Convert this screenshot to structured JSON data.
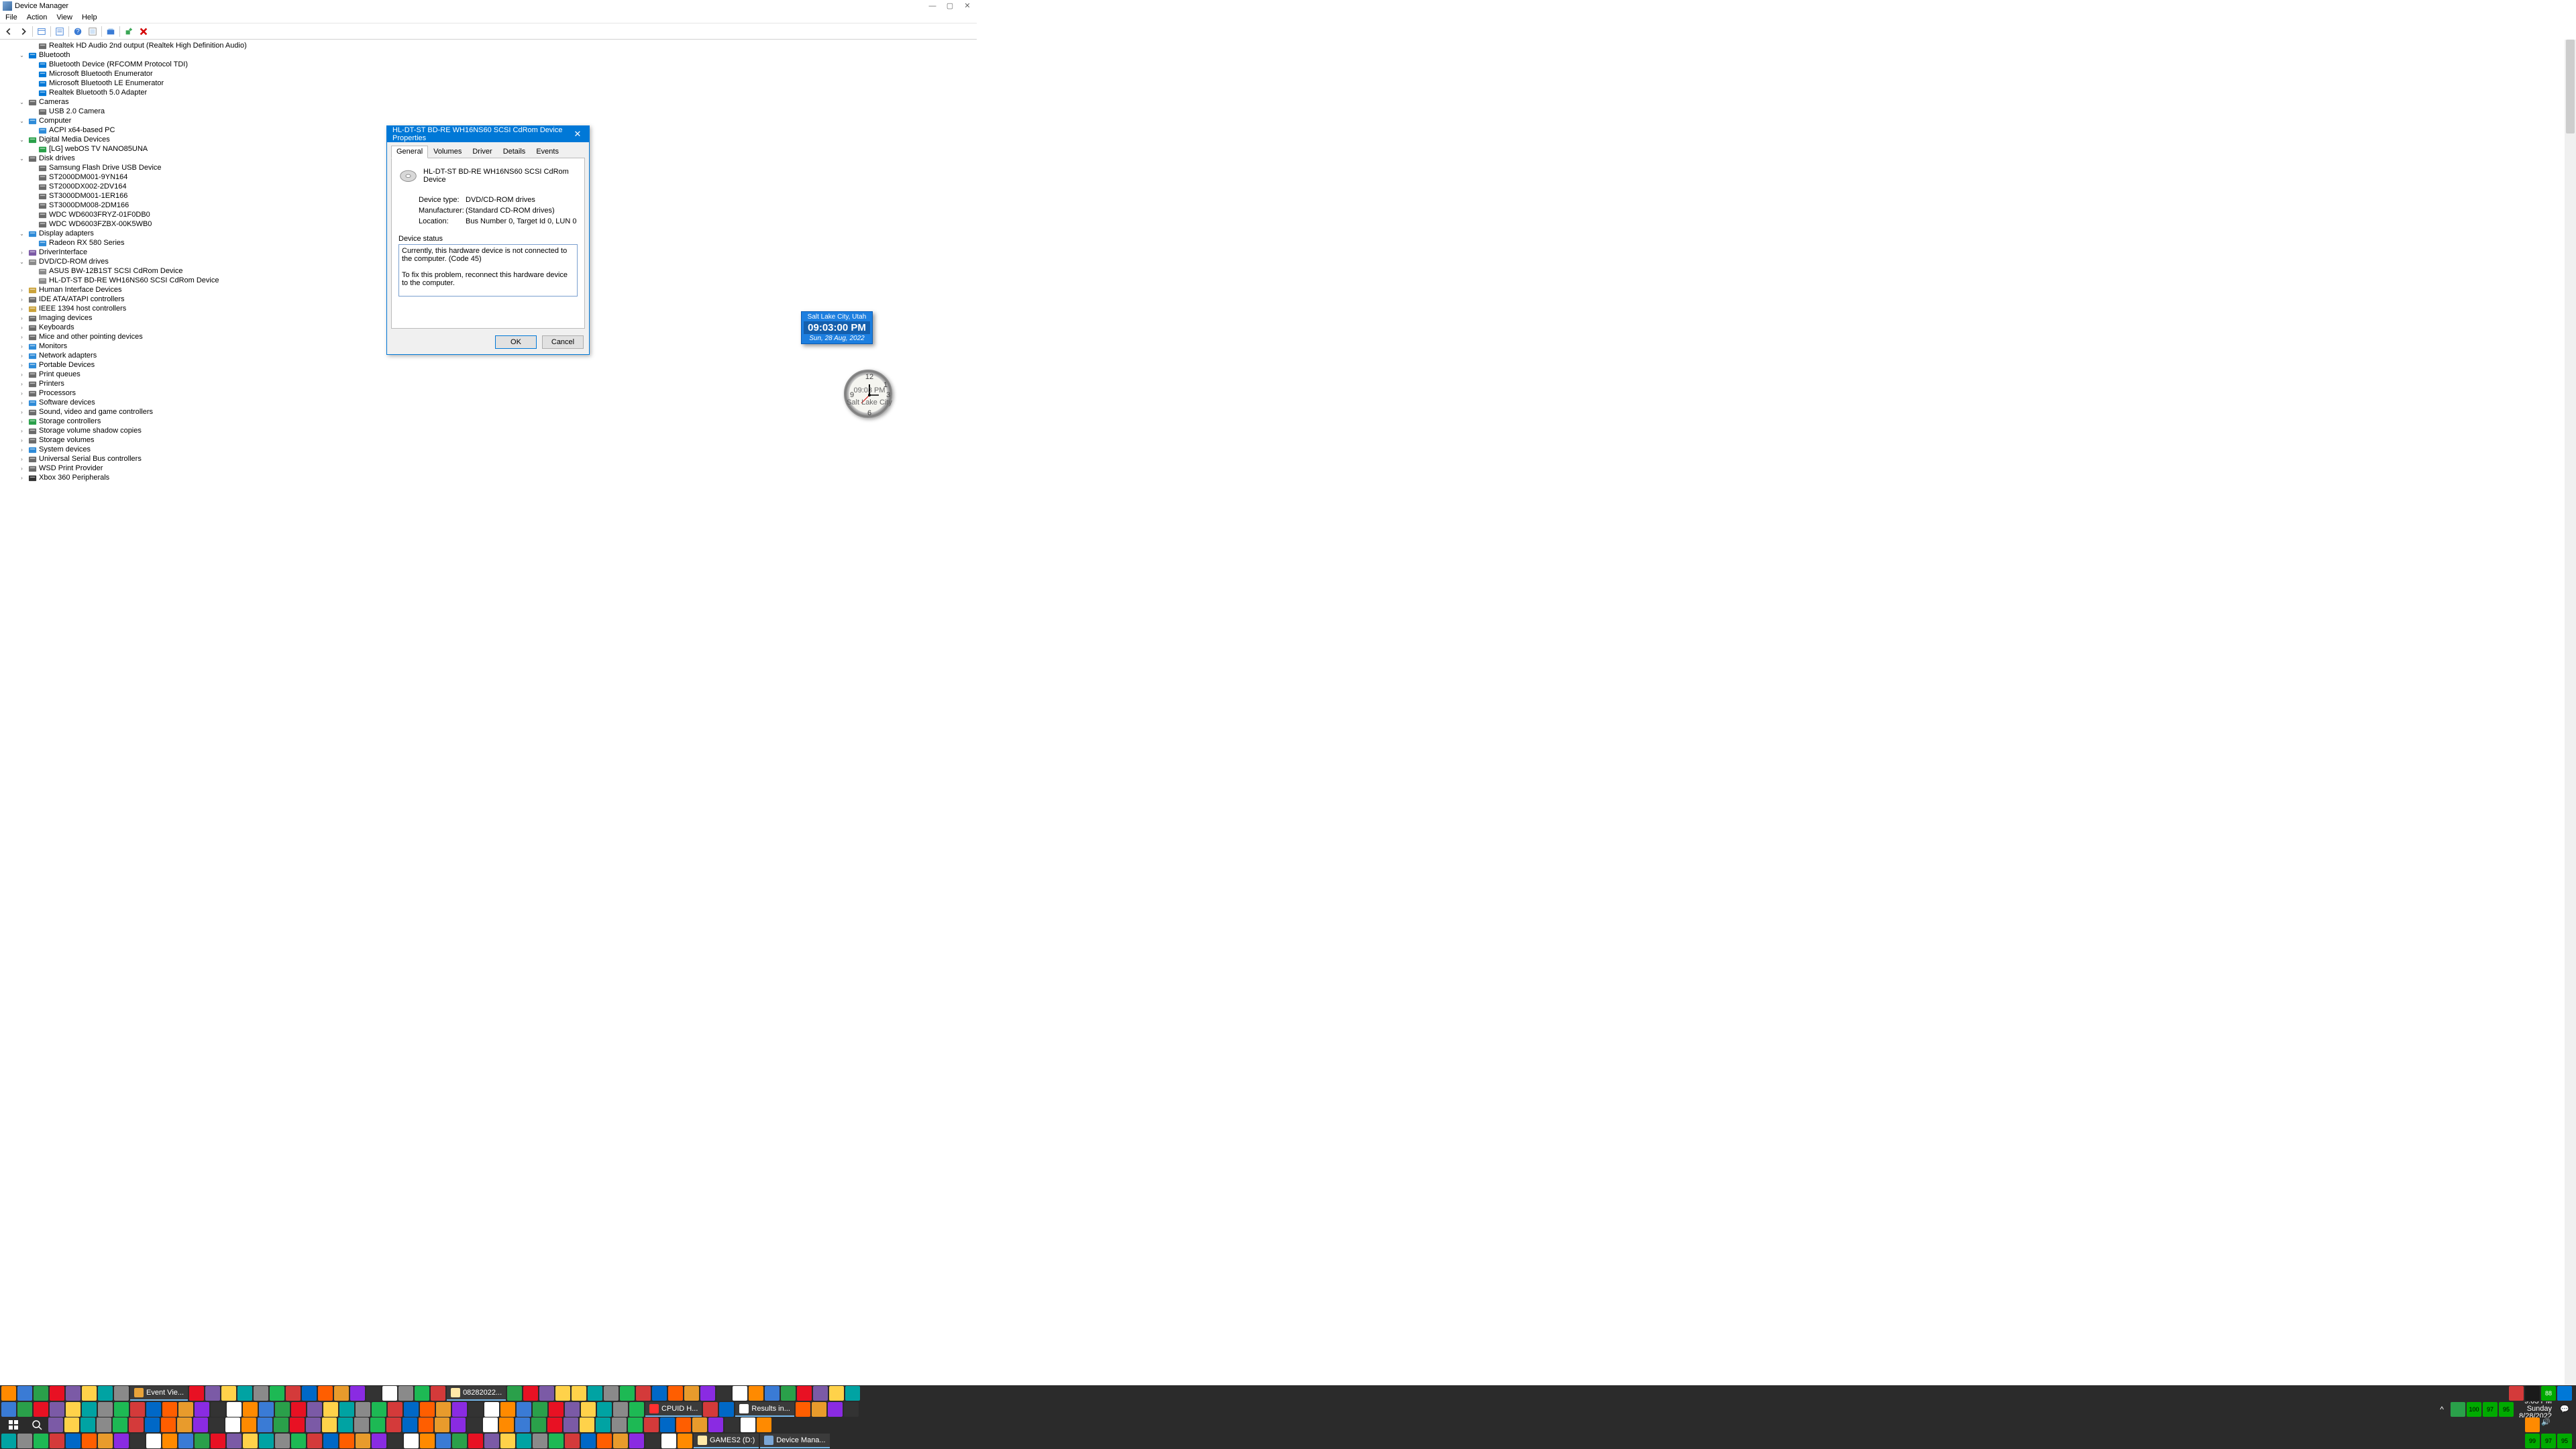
{
  "window": {
    "title": "Device Manager",
    "menu": [
      "File",
      "Action",
      "View",
      "Help"
    ]
  },
  "tree": [
    {
      "d": 2,
      "e": "",
      "i": "audio",
      "t": "Realtek HD Audio 2nd output (Realtek High Definition Audio)"
    },
    {
      "d": 1,
      "e": "v",
      "i": "bt",
      "t": "Bluetooth"
    },
    {
      "d": 2,
      "e": "",
      "i": "bt",
      "t": "Bluetooth Device (RFCOMM Protocol TDI)"
    },
    {
      "d": 2,
      "e": "",
      "i": "bt",
      "t": "Microsoft Bluetooth Enumerator"
    },
    {
      "d": 2,
      "e": "",
      "i": "bt",
      "t": "Microsoft Bluetooth LE Enumerator"
    },
    {
      "d": 2,
      "e": "",
      "i": "bt",
      "t": "Realtek Bluetooth 5.0 Adapter"
    },
    {
      "d": 1,
      "e": "v",
      "i": "cam",
      "t": "Cameras"
    },
    {
      "d": 2,
      "e": "",
      "i": "cam",
      "t": "USB 2.0 Camera"
    },
    {
      "d": 1,
      "e": "v",
      "i": "pc",
      "t": "Computer"
    },
    {
      "d": 2,
      "e": "",
      "i": "pc",
      "t": "ACPI x64-based PC"
    },
    {
      "d": 1,
      "e": "v",
      "i": "media",
      "t": "Digital Media Devices"
    },
    {
      "d": 2,
      "e": "",
      "i": "media",
      "t": "[LG] webOS TV NANO85UNA"
    },
    {
      "d": 1,
      "e": "v",
      "i": "disk",
      "t": "Disk drives"
    },
    {
      "d": 2,
      "e": "",
      "i": "disk",
      "t": "Samsung Flash Drive USB Device"
    },
    {
      "d": 2,
      "e": "",
      "i": "disk",
      "t": "ST2000DM001-9YN164"
    },
    {
      "d": 2,
      "e": "",
      "i": "disk",
      "t": "ST2000DX002-2DV164"
    },
    {
      "d": 2,
      "e": "",
      "i": "disk",
      "t": "ST3000DM001-1ER166"
    },
    {
      "d": 2,
      "e": "",
      "i": "disk",
      "t": "ST3000DM008-2DM166"
    },
    {
      "d": 2,
      "e": "",
      "i": "disk",
      "t": "WDC WD6003FRYZ-01F0DB0"
    },
    {
      "d": 2,
      "e": "",
      "i": "disk",
      "t": "WDC WD6003FZBX-00K5WB0"
    },
    {
      "d": 1,
      "e": "v",
      "i": "display",
      "t": "Display adapters"
    },
    {
      "d": 2,
      "e": "",
      "i": "display",
      "t": "Radeon RX 580 Series"
    },
    {
      "d": 1,
      "e": ">",
      "i": "drv",
      "t": "DriverInterface"
    },
    {
      "d": 1,
      "e": "v",
      "i": "cd",
      "t": "DVD/CD-ROM drives"
    },
    {
      "d": 2,
      "e": "",
      "i": "cd",
      "t": "ASUS BW-12B1ST SCSI CdRom Device"
    },
    {
      "d": 2,
      "e": "",
      "i": "cd",
      "t": "HL-DT-ST BD-RE  WH16NS60 SCSI CdRom Device"
    },
    {
      "d": 1,
      "e": ">",
      "i": "hid",
      "t": "Human Interface Devices"
    },
    {
      "d": 1,
      "e": ">",
      "i": "ide",
      "t": "IDE ATA/ATAPI controllers"
    },
    {
      "d": 1,
      "e": ">",
      "i": "1394",
      "t": "IEEE 1394 host controllers"
    },
    {
      "d": 1,
      "e": ">",
      "i": "img",
      "t": "Imaging devices"
    },
    {
      "d": 1,
      "e": ">",
      "i": "kb",
      "t": "Keyboards"
    },
    {
      "d": 1,
      "e": ">",
      "i": "mouse",
      "t": "Mice and other pointing devices"
    },
    {
      "d": 1,
      "e": ">",
      "i": "mon",
      "t": "Monitors"
    },
    {
      "d": 1,
      "e": ">",
      "i": "net",
      "t": "Network adapters"
    },
    {
      "d": 1,
      "e": ">",
      "i": "port",
      "t": "Portable Devices"
    },
    {
      "d": 1,
      "e": ">",
      "i": "pq",
      "t": "Print queues"
    },
    {
      "d": 1,
      "e": ">",
      "i": "prn",
      "t": "Printers"
    },
    {
      "d": 1,
      "e": ">",
      "i": "cpu",
      "t": "Processors"
    },
    {
      "d": 1,
      "e": ">",
      "i": "sw",
      "t": "Software devices"
    },
    {
      "d": 1,
      "e": ">",
      "i": "snd",
      "t": "Sound, video and game controllers"
    },
    {
      "d": 1,
      "e": ">",
      "i": "stor",
      "t": "Storage controllers"
    },
    {
      "d": 1,
      "e": ">",
      "i": "vol",
      "t": "Storage volume shadow copies"
    },
    {
      "d": 1,
      "e": ">",
      "i": "vol",
      "t": "Storage volumes"
    },
    {
      "d": 1,
      "e": ">",
      "i": "sys",
      "t": "System devices"
    },
    {
      "d": 1,
      "e": ">",
      "i": "usb",
      "t": "Universal Serial Bus controllers"
    },
    {
      "d": 1,
      "e": ">",
      "i": "wsd",
      "t": "WSD Print Provider"
    },
    {
      "d": 1,
      "e": ">",
      "i": "xbox",
      "t": "Xbox 360 Peripherals"
    }
  ],
  "dialog": {
    "title": "HL-DT-ST BD-RE  WH16NS60 SCSI CdRom Device Properties",
    "tabs": [
      "General",
      "Volumes",
      "Driver",
      "Details",
      "Events"
    ],
    "active_tab": "General",
    "device_name": "HL-DT-ST BD-RE  WH16NS60 SCSI CdRom Device",
    "rows": {
      "type_lbl": "Device type:",
      "type_val": "DVD/CD-ROM drives",
      "mfr_lbl": "Manufacturer:",
      "mfr_val": "(Standard CD-ROM drives)",
      "loc_lbl": "Location:",
      "loc_val": "Bus Number 0, Target Id 0, LUN 0"
    },
    "status_caption": "Device status",
    "status_text": "Currently, this hardware device is not connected to the computer. (Code 45)\n\nTo fix this problem, reconnect this hardware device to the computer.",
    "ok": "OK",
    "cancel": "Cancel"
  },
  "digital_clock": {
    "loc": "Salt Lake City, Utah",
    "time": "09:03:00 PM",
    "date": "Sun, 28 Aug, 2022"
  },
  "taskbar": {
    "row1_tasks": [
      {
        "l": "Event Vie...",
        "c": "#e8a33a"
      },
      {
        "l": "08282022...",
        "c": "#ffe9a8"
      },
      {
        "l": "CPUID H...",
        "c": "#ff3030"
      },
      {
        "l": "Results in...",
        "c": "#ffffff"
      }
    ],
    "row4_tasks": [
      {
        "l": "GAMES2 (D:)",
        "c": "#ffe9a8"
      },
      {
        "l": "Device Mana...",
        "c": "#7aa6d6"
      }
    ],
    "clock": {
      "time": "9:03 PM",
      "day": "Sunday",
      "date": "8/28/2022"
    },
    "tray_badges": [
      "88",
      "100",
      "97",
      "95",
      "99",
      "97",
      "95"
    ]
  },
  "icon_colors": {
    "audio": "#6b6b6b",
    "bt": "#0078d7",
    "cam": "#6b6b6b",
    "pc": "#2e8bd8",
    "media": "#2aa04a",
    "disk": "#6b6b6b",
    "display": "#2e8bd8",
    "drv": "#7c5aa6",
    "cd": "#8a8a8a",
    "hid": "#caa23a",
    "ide": "#6b6b6b",
    "1394": "#caa23a",
    "img": "#6b6b6b",
    "kb": "#6b6b6b",
    "mouse": "#6b6b6b",
    "mon": "#2e8bd8",
    "net": "#2e8bd8",
    "port": "#2e8bd8",
    "pq": "#6b6b6b",
    "prn": "#6b6b6b",
    "cpu": "#6b6b6b",
    "sw": "#2e8bd8",
    "snd": "#6b6b6b",
    "stor": "#2aa04a",
    "vol": "#6b6b6b",
    "sys": "#2e8bd8",
    "usb": "#6b6b6b",
    "wsd": "#6b6b6b",
    "xbox": "#333333"
  },
  "taskbar_icon_colors": [
    [
      "#ffe9a8",
      "#1a1a1a",
      "#3a7bd5",
      "#8fd14f",
      "#e06b2c",
      "#3a7bd5",
      "#7b5aa6",
      "#e8a33a"
    ],
    [
      "#d43a3a",
      "#ff8a00",
      "#7b7b7b",
      "#2b6fb3",
      "#ffd24a",
      "#a0a0a0",
      "#ffd24a",
      "#2b6fb3",
      "#00a3a3",
      "#7b5aa6",
      "#2b6fb3",
      "#ff6a00",
      "#ff6a00",
      "#8a8a8a",
      "#ff3030",
      "#1db954",
      "#1a1a1a",
      "#e81123",
      "#0063b1",
      "#ffffff",
      "#7b5aa6",
      "#0078d7",
      "#2b2b2b",
      "#00a4ef",
      "#8a8a8a"
    ],
    [
      "#ffe9a8",
      "#ff3030",
      "#ffb100",
      "#e81123",
      "#ffffff",
      "#0078d7",
      "#7b5aa6",
      "#e81123",
      "#ff6a00",
      "#2b6fb3",
      "#ff8a00",
      "#ff5e00",
      "#e81123",
      "#e89b2c",
      "#7b5aa6",
      "#8a2be2",
      "#0068c7",
      "#d43a3a"
    ],
    [
      "#d43a3a",
      "#3a7bd5",
      "#3a7bd5",
      "#ffffff",
      "#ff8a00",
      "#00a86b",
      "#1a1a1a",
      "#8a8a8a",
      "#0068c7"
    ]
  ],
  "row1_left_count": 8,
  "row1_mid_count": 13,
  "row1_mid2_count": 3,
  "row1_after_task2": 4,
  "row1_tail": 18,
  "row2_count": 40,
  "row3_count": 45,
  "row4_left_count": 43
}
